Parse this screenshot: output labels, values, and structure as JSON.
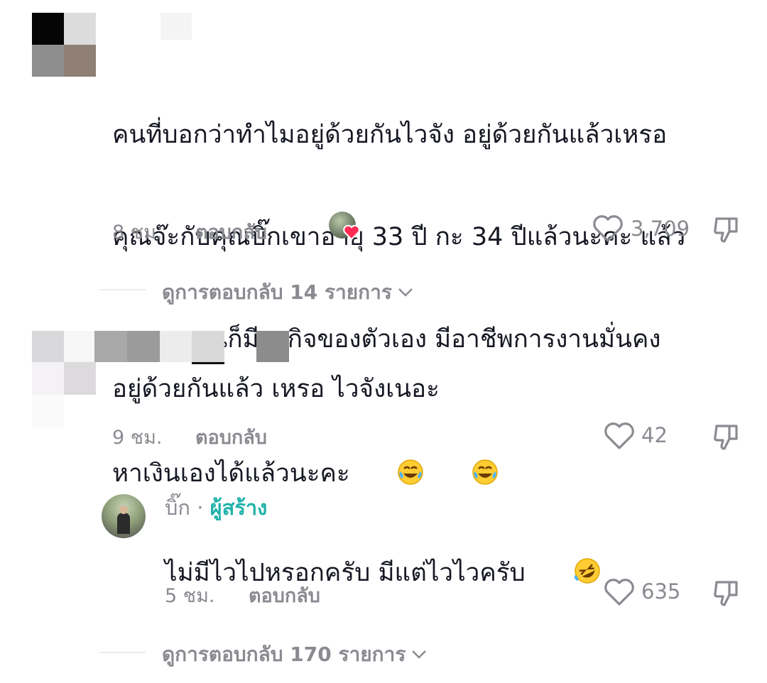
{
  "comments": [
    {
      "text": "คนที่บอกว่าทำไมอยู่ด้วยกันไวจัง อยู่ด้วยกันแล้วเหรอ คุณจ๊ะกับคุณบิ๊กเขาอายุ 33 ปี กะ 34 ปีแล้วนะคะ แล้ว เขาสองคนก็มีธุรกิจของตัวเอง มีอาชีพการงานมั่นคง หาเงินเองได้แล้วนะคะ",
      "lines": [
        "คนที่บอกว่าทำไมอยู่ด้วยกันไวจัง อยู่ด้วยกันแล้วเหรอ",
        "คุณจ๊ะกับคุณบิ๊กเขาอายุ 33 ปี กะ 34 ปีแล้วนะคะ แล้ว",
        "เขาสองคนก็มีธุรกิจของตัวเอง มีอาชีพการงานมั่นคง",
        "หาเงินเองได้แล้วนะคะ"
      ],
      "trailing_emoji": "joy-emoji x2",
      "time": "8 ชม.",
      "reply_label": "ตอบกลับ",
      "likes": "3,709",
      "creator_liked": true,
      "view_replies": "ดูการตอบกลับ 14 รายการ"
    },
    {
      "text": "อยู่ด้วยกันแล้ว เหรอ ไวจังเนอะ",
      "time": "9 ชม.",
      "reply_label": "ตอบกลับ",
      "likes": "42",
      "reply": {
        "author": "บิ๊ก",
        "separator": "·",
        "badge": "ผู้สร้าง",
        "text": "ไม่มีไวไปหรอกครับ มีแต่ไวไวครับ",
        "trailing_emoji": "rofl-emoji",
        "time": "5 ชม.",
        "reply_label": "ตอบกลับ",
        "likes": "635"
      },
      "view_replies": "ดูการตอบกลับ 170 รายการ"
    }
  ],
  "colors": {
    "text": "#161823",
    "muted": "#8a8b91",
    "creator_badge": "#20b2aa",
    "heart_badge": "#fe2c55"
  }
}
